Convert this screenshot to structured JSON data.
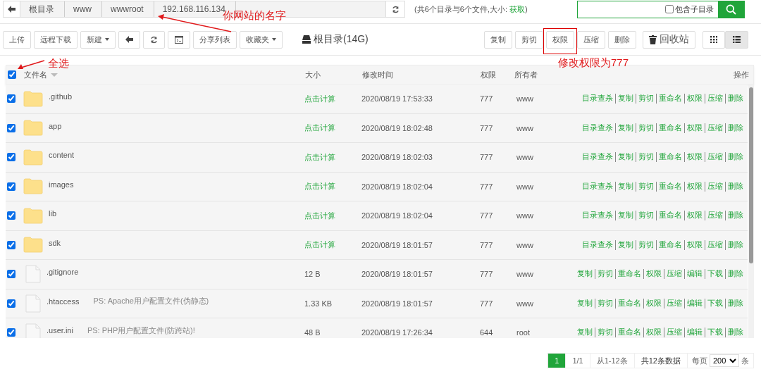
{
  "breadcrumb": [
    "根目录",
    "www",
    "wwwroot",
    "192.168.116.134"
  ],
  "summary": {
    "text": "(共6个目录与6个文件,大小: ",
    "link": "获取",
    "end": ")"
  },
  "search": {
    "option_label": "包含子目录",
    "option_checked": false
  },
  "toolbar": [
    {
      "kind": "text",
      "label": "上传"
    },
    {
      "kind": "text",
      "label": "远程下载"
    },
    {
      "kind": "dropdown",
      "label": "新建"
    },
    {
      "kind": "back"
    },
    {
      "kind": "refresh"
    },
    {
      "kind": "terminal"
    },
    {
      "kind": "text",
      "label": "分享列表"
    },
    {
      "kind": "dropdown",
      "label": "收藏夹"
    }
  ],
  "disk_label": "根目录(14G)",
  "batch_buttons": [
    {
      "label": "复制",
      "highlighted": false
    },
    {
      "label": "剪切",
      "highlighted": false
    },
    {
      "label": "权限",
      "highlighted": true
    },
    {
      "label": "压缩",
      "highlighted": false
    },
    {
      "label": "删除",
      "highlighted": false
    }
  ],
  "recycle_button": "回收站",
  "views": [
    {
      "kind": "grid",
      "selected": false
    },
    {
      "kind": "list",
      "selected": true
    }
  ],
  "table": {
    "all_checked": true,
    "columns": [
      "文件名",
      "大小",
      "修改时间",
      "权限",
      "所有者",
      "操作"
    ],
    "rows": [
      {
        "kind": "folder",
        "checked": true,
        "name": ".github",
        "size": "点击计算",
        "modified": "2020/08/19 17:53:33",
        "perm": "777",
        "owner": "www",
        "actions": [
          "目录查杀",
          "复制",
          "剪切",
          "重命名",
          "权限",
          "压缩",
          "删除"
        ]
      },
      {
        "kind": "folder",
        "checked": true,
        "name": "app",
        "size": "点击计算",
        "modified": "2020/08/19 18:02:48",
        "perm": "777",
        "owner": "www",
        "actions": [
          "目录查杀",
          "复制",
          "剪切",
          "重命名",
          "权限",
          "压缩",
          "删除"
        ]
      },
      {
        "kind": "folder",
        "checked": true,
        "name": "content",
        "size": "点击计算",
        "modified": "2020/08/19 18:02:03",
        "perm": "777",
        "owner": "www",
        "actions": [
          "目录查杀",
          "复制",
          "剪切",
          "重命名",
          "权限",
          "压缩",
          "删除"
        ]
      },
      {
        "kind": "folder",
        "checked": true,
        "name": "images",
        "size": "点击计算",
        "modified": "2020/08/19 18:02:04",
        "perm": "777",
        "owner": "www",
        "actions": [
          "目录查杀",
          "复制",
          "剪切",
          "重命名",
          "权限",
          "压缩",
          "删除"
        ]
      },
      {
        "kind": "folder",
        "checked": true,
        "name": "lib",
        "size": "点击计算",
        "modified": "2020/08/19 18:02:04",
        "perm": "777",
        "owner": "www",
        "actions": [
          "目录查杀",
          "复制",
          "剪切",
          "重命名",
          "权限",
          "压缩",
          "删除"
        ]
      },
      {
        "kind": "folder",
        "checked": true,
        "name": "sdk",
        "size": "点击计算",
        "modified": "2020/08/19 18:01:57",
        "perm": "777",
        "owner": "www",
        "actions": [
          "目录查杀",
          "复制",
          "剪切",
          "重命名",
          "权限",
          "压缩",
          "删除"
        ]
      },
      {
        "kind": "file",
        "checked": true,
        "name": ".gitignore",
        "size": "12 B",
        "modified": "2020/08/19 18:01:57",
        "perm": "777",
        "owner": "www",
        "actions": [
          "复制",
          "剪切",
          "重命名",
          "权限",
          "压缩",
          "编辑",
          "下载",
          "删除"
        ]
      },
      {
        "kind": "file",
        "checked": true,
        "name": ".htaccess",
        "note": "PS: Apache用户配置文件(伪静态)",
        "size": "1.33 KB",
        "modified": "2020/08/19 18:01:57",
        "perm": "777",
        "owner": "www",
        "actions": [
          "复制",
          "剪切",
          "重命名",
          "权限",
          "压缩",
          "编辑",
          "下载",
          "删除"
        ]
      },
      {
        "kind": "file",
        "checked": true,
        "name": ".user.ini",
        "note": "PS: PHP用户配置文件(防跨站)!",
        "size": "48 B",
        "modified": "2020/08/19 17:26:34",
        "perm": "644",
        "owner": "root",
        "actions": [
          "复制",
          "剪切",
          "重命名",
          "权限",
          "压缩",
          "编辑",
          "下载",
          "删除"
        ]
      }
    ]
  },
  "pagination": {
    "current": "1",
    "pages": "1/1",
    "range": "从1-12条",
    "total": "共12条数据",
    "per_page_label": "每页",
    "per_page": "200",
    "unit": "条"
  },
  "annotations": [
    {
      "text": "你网站的名字"
    },
    {
      "text": "全选"
    },
    {
      "text": "修改权限为777"
    }
  ]
}
